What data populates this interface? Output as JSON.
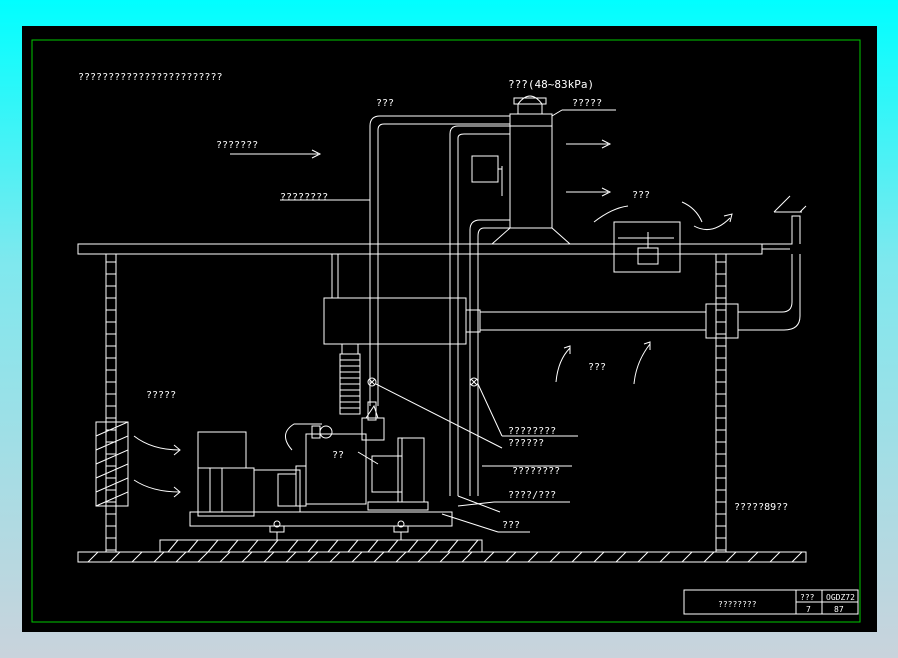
{
  "colors": {
    "line": "#ffffff",
    "border": "#00c800",
    "background": "#000000",
    "desktop": "#00ffff"
  },
  "labels": {
    "top_title": "????????????????????????",
    "muffler_pressure": "???(48~83kPa)",
    "pipe_top": "???",
    "muffler": "?????",
    "airflow_in": "???????",
    "exhaust_pipe": "????????",
    "rain_cap": "???",
    "air_intake": "?????",
    "hot_air": "???",
    "flexible_line1": "????????",
    "flexible_line2": "??????",
    "engine_label": "??",
    "drain": "????????",
    "condensate": "????/???",
    "base": "???",
    "wall_note": "?????89??"
  },
  "title_block": {
    "name": "????????",
    "col1_header": "???",
    "col2_header": "OGDZ72",
    "col1_value": "7",
    "col2_value": "87"
  }
}
